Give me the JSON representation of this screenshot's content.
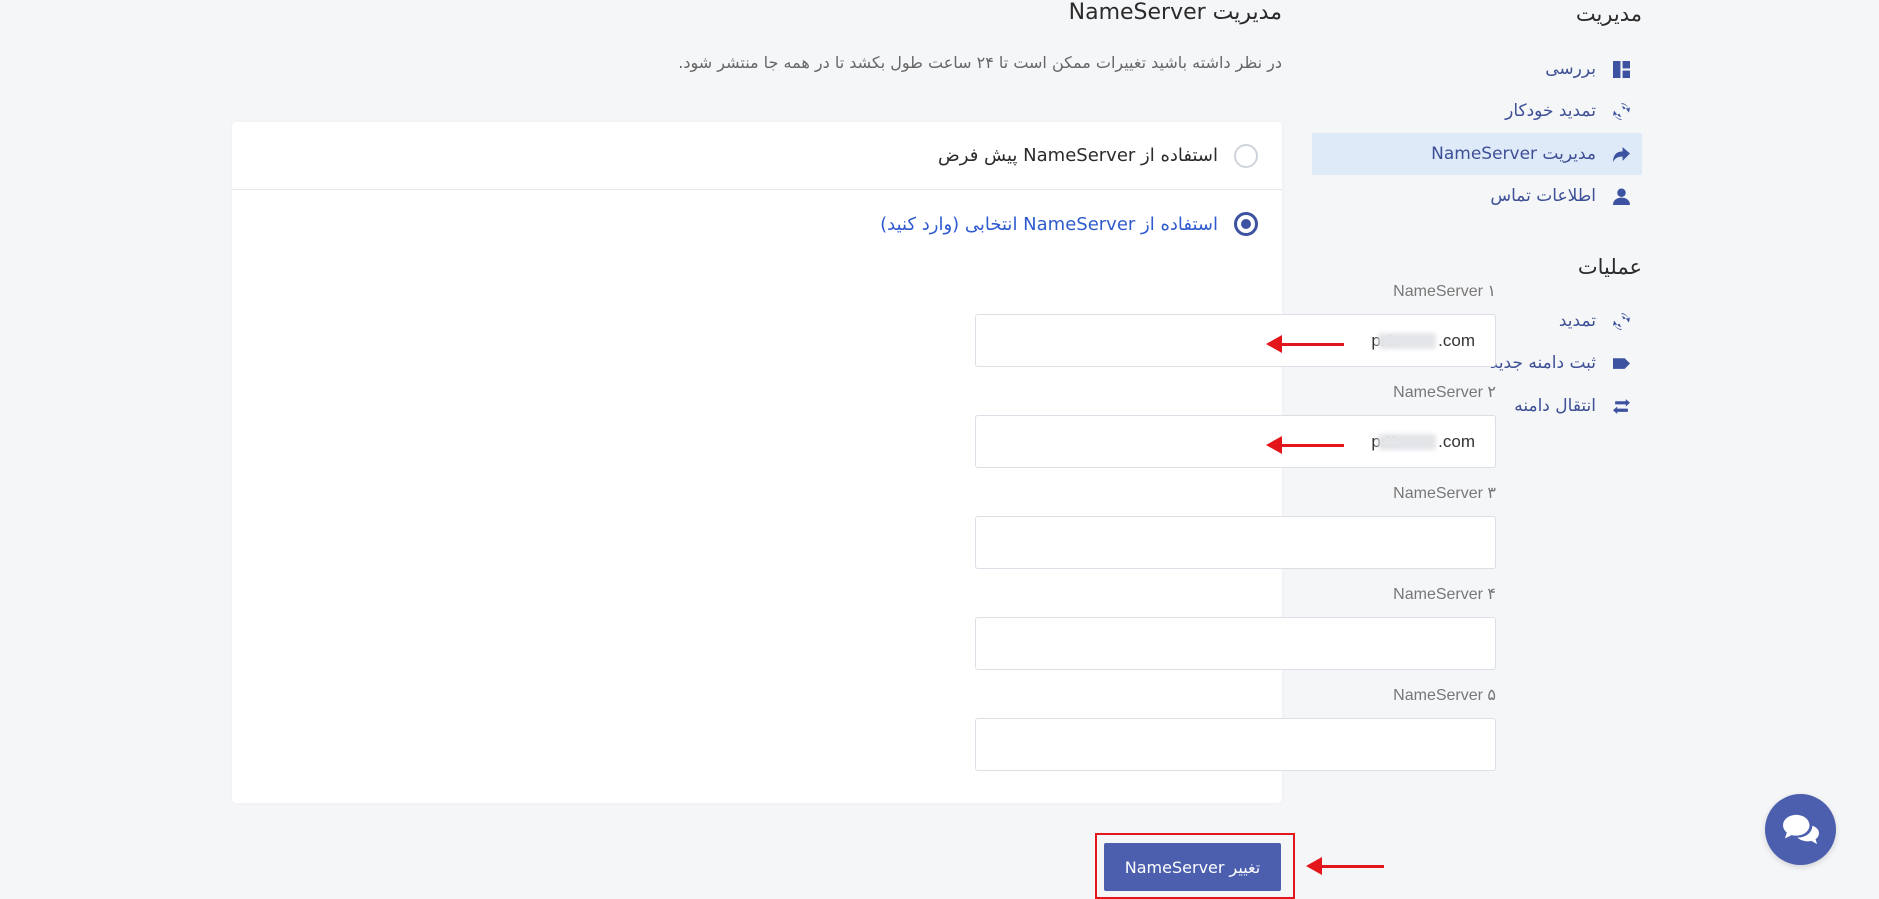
{
  "sidebar": {
    "management_heading": "مدیریت",
    "management_items": [
      {
        "label": "بررسی",
        "icon": "dashboard-icon"
      },
      {
        "label": "تمدید خودکار",
        "icon": "sync-icon"
      },
      {
        "label": "مدیریت NameServer",
        "icon": "share-arrow-icon"
      },
      {
        "label": "اطلاعات تماس",
        "icon": "user-icon"
      }
    ],
    "operations_heading": "عملیات",
    "operations_items": [
      {
        "label": "تمدید",
        "icon": "sync-icon"
      },
      {
        "label": "ثبت دامنه جدید",
        "icon": "tag-icon"
      },
      {
        "label": "انتقال دامنه",
        "icon": "exchange-icon"
      }
    ]
  },
  "main": {
    "title": "مدیریت NameServer",
    "subtitle": "در نظر داشته باشید تغییرات ممکن است تا ۲۴ ساعت طول بکشد تا در همه جا منتشر شود.",
    "option_default": "استفاده از NameServer پیش فرض",
    "option_custom": "استفاده از NameServer انتخابی (وارد کنید)",
    "nameservers": [
      {
        "label": "NameServer ۱",
        "value": "pr۱.        .com"
      },
      {
        "label": "NameServer ۲",
        "value": "pr۲.        .com"
      },
      {
        "label": "NameServer ۳",
        "value": ""
      },
      {
        "label": "NameServer ۴",
        "value": ""
      },
      {
        "label": "NameServer ۵",
        "value": ""
      }
    ],
    "submit_label": "تغییر NameServer"
  },
  "colors": {
    "accent": "#3d52a0",
    "button": "#4b5fae",
    "annotation": "#e3161b",
    "active_sidebar_bg": "#dfeaf9"
  }
}
